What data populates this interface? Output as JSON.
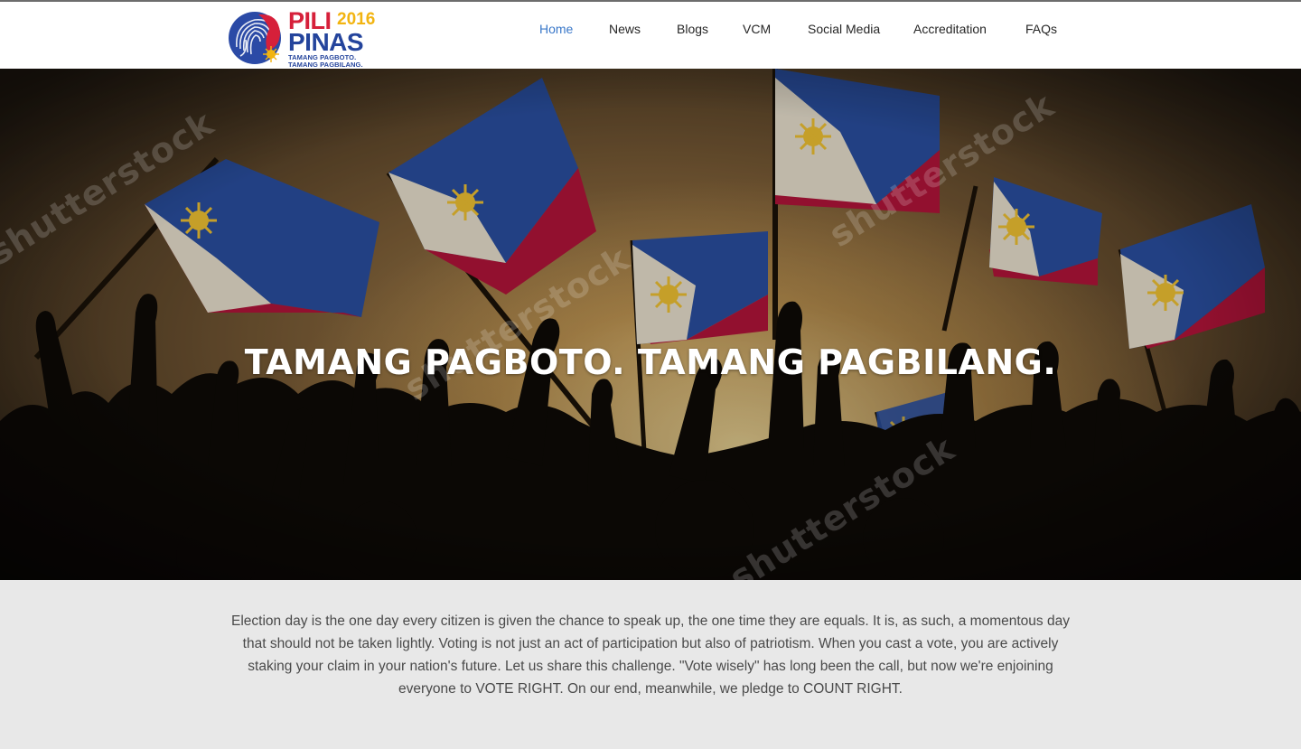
{
  "header": {
    "logo": {
      "word1": "PILI",
      "year": "2016",
      "word2": "PINAS",
      "tagline_line1": "TAMANG PAGBOTO.",
      "tagline_line2": "TAMANG PAGBILANG."
    },
    "nav": [
      {
        "label": "Home",
        "active": true
      },
      {
        "label": "News"
      },
      {
        "label": "Blogs"
      },
      {
        "label": "VCM"
      },
      {
        "label": "Social Media"
      },
      {
        "label": "Accreditation"
      },
      {
        "label": "FAQs"
      }
    ]
  },
  "hero": {
    "title": "TAMANG PAGBOTO. TAMANG PAGBILANG.",
    "watermark": "shutterstock"
  },
  "intro": {
    "text": "Election day is the one day every citizen is given the chance to speak up, the one time they are equals. It is, as such, a momentous day that should not be taken lightly. Voting is not just an act of participation but also of patriotism. When you cast a vote, you are actively staking your claim in your nation's future. Let us share this challenge. \"Vote wisely\" has long been the call, but now we're enjoining everyone to VOTE RIGHT. On our end, meanwhile, we pledge to COUNT RIGHT."
  },
  "colors": {
    "nav_active": "#3a78c9",
    "logo_red": "#d6203a",
    "logo_blue": "#24449c",
    "logo_yellow": "#f2b411",
    "flag_blue": "#2a4fa0",
    "flag_red": "#b3143a"
  }
}
